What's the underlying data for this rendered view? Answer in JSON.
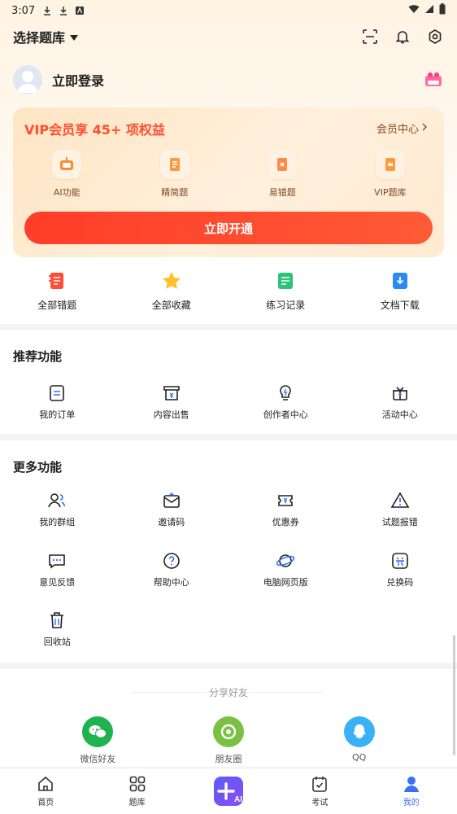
{
  "status_bar": {
    "time": "3:07"
  },
  "header": {
    "title": "选择题库"
  },
  "profile": {
    "login_label": "立即登录"
  },
  "vip": {
    "title": "VIP会员享 45+ 项权益",
    "center_link": "会员中心",
    "items": [
      {
        "label": "AI功能",
        "icon": "ai-robot-icon"
      },
      {
        "label": "精简题",
        "icon": "doc-icon"
      },
      {
        "label": "易错题",
        "icon": "error-book-icon"
      },
      {
        "label": "VIP题库",
        "icon": "vip-book-icon"
      }
    ],
    "open_button": "立即开通"
  },
  "quick": [
    {
      "label": "全部错题"
    },
    {
      "label": "全部收藏"
    },
    {
      "label": "练习记录"
    },
    {
      "label": "文档下载"
    }
  ],
  "recommend": {
    "title": "推荐功能",
    "items": [
      {
        "label": "我的订单"
      },
      {
        "label": "内容出售"
      },
      {
        "label": "创作者中心"
      },
      {
        "label": "活动中心"
      }
    ]
  },
  "more": {
    "title": "更多功能",
    "row1": [
      {
        "label": "我的群组"
      },
      {
        "label": "邀请码"
      },
      {
        "label": "优惠券"
      },
      {
        "label": "试题报错"
      }
    ],
    "row2": [
      {
        "label": "意见反馈"
      },
      {
        "label": "帮助中心"
      },
      {
        "label": "电脑网页版"
      },
      {
        "label": "兑换码"
      }
    ],
    "row3": [
      {
        "label": "回收站"
      }
    ]
  },
  "share": {
    "title": "分享好友",
    "items": [
      {
        "label": "微信好友",
        "color": "#1fb34f"
      },
      {
        "label": "朋友圈",
        "color": "#7ac143"
      },
      {
        "label": "QQ",
        "color": "#3ab0f5"
      }
    ]
  },
  "nav": [
    {
      "label": "首页"
    },
    {
      "label": "题库"
    },
    {
      "label": ""
    },
    {
      "label": "考试"
    },
    {
      "label": "我的"
    }
  ],
  "colors": {
    "accent": "#ff4d2e",
    "active_nav": "#3a6ff7",
    "ai_gradient_start": "#5b5cf6"
  }
}
